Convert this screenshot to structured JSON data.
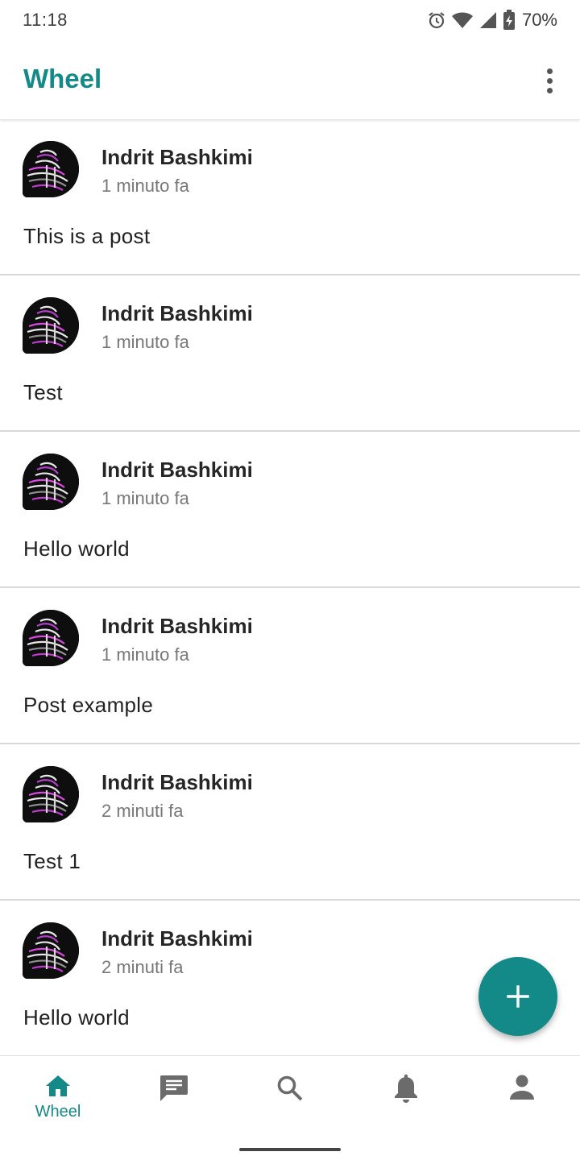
{
  "status_bar": {
    "time": "11:18",
    "battery": "70%",
    "icons": [
      "alarm-icon",
      "wifi-icon",
      "signal-icon",
      "battery-charging-icon"
    ]
  },
  "app_bar": {
    "title": "Wheel",
    "menu_icon": "more-vert-icon",
    "accent_color": "#138a87"
  },
  "posts": [
    {
      "author": "Indrit Bashkimi",
      "time": "1 minuto fa",
      "text": "This is a post"
    },
    {
      "author": "Indrit Bashkimi",
      "time": "1 minuto fa",
      "text": "Test"
    },
    {
      "author": "Indrit Bashkimi",
      "time": "1 minuto fa",
      "text": "Hello world"
    },
    {
      "author": "Indrit Bashkimi",
      "time": "1 minuto fa",
      "text": "Post example"
    },
    {
      "author": "Indrit Bashkimi",
      "time": "2 minuti fa",
      "text": "Test 1"
    },
    {
      "author": "Indrit Bashkimi",
      "time": "2 minuti fa",
      "text": "Hello world"
    }
  ],
  "fab": {
    "icon": "plus-icon"
  },
  "bottom_nav": {
    "active_label": "Wheel",
    "items": [
      {
        "icon": "home-icon",
        "label": "Wheel",
        "active": true
      },
      {
        "icon": "chat-icon",
        "active": false
      },
      {
        "icon": "search-icon",
        "active": false
      },
      {
        "icon": "bell-icon",
        "active": false
      },
      {
        "icon": "person-icon",
        "active": false
      }
    ]
  }
}
